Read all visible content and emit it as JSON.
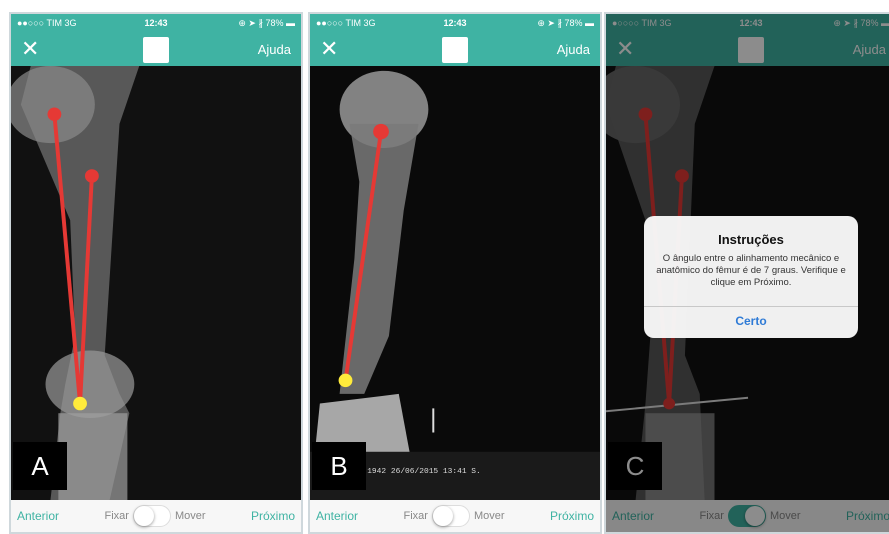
{
  "panels": [
    {
      "id": "A",
      "label": "A",
      "status": {
        "carrier": "●●○○○ TIM 3G",
        "time": "12:43",
        "right": "⊕ ➤ ∦ 78% ▬"
      },
      "nav": {
        "close": "✕",
        "help": "Ajuda",
        "logo_icon": "bone-logo-icon"
      },
      "bottom": {
        "prev": "Anterior",
        "fix": "Fixar",
        "move": "Mover",
        "next": "Próximo",
        "toggle_on": false
      }
    },
    {
      "id": "B",
      "label": "B",
      "status": {
        "carrier": "●●○○○ TIM 3G",
        "time": "12:43",
        "right": "⊕ ➤ ∦ 78% ▬"
      },
      "nav": {
        "close": "✕",
        "help": "Ajuda",
        "logo_icon": "bone-logo-icon"
      },
      "bottom": {
        "prev": "Anterior",
        "fix": "Fixar",
        "move": "Mover",
        "next": "Próximo",
        "toggle_on": false
      },
      "film_text": "1942 26/06/2015 13:41 S."
    },
    {
      "id": "C",
      "label": "C",
      "status": {
        "carrier": "●○○○○ TIM 3G",
        "time": "12:43",
        "right": "⊕ ➤ ∦ 78% ▬"
      },
      "nav": {
        "close": "✕",
        "help": "Ajuda",
        "logo_icon": "bone-logo-icon"
      },
      "bottom": {
        "prev": "Anterior",
        "fix": "Fixar",
        "move": "Mover",
        "next": "Próximo",
        "toggle_on": true
      },
      "alert": {
        "title": "Instruções",
        "message": "O ângulo entre o alinhamento mecânico e anatômico do fêmur é de 7 graus. Verifique e clique em Próximo.",
        "button": "Certo"
      }
    }
  ],
  "colors": {
    "accent": "#3fb3a3",
    "line": "#e53935",
    "marker_yellow": "#ffeb3b",
    "alert_button": "#2f7bd6"
  }
}
